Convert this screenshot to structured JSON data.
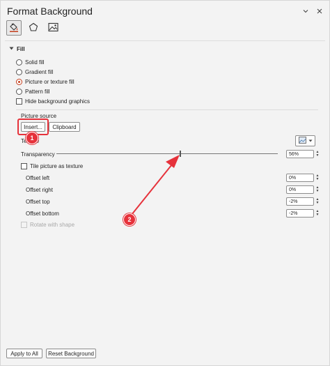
{
  "header": {
    "title": "Format Background",
    "chevron_icon": "chevron-down-icon",
    "close_icon": "close-icon"
  },
  "tabs": [
    {
      "name": "fill-tab",
      "icon": "paint-bucket-icon",
      "active": true
    },
    {
      "name": "effects-tab",
      "icon": "pentagon-icon",
      "active": false
    },
    {
      "name": "picture-tab",
      "icon": "image-icon",
      "active": false
    }
  ],
  "fill": {
    "section_label": "Fill",
    "options": [
      {
        "label": "Solid fill",
        "checked": false
      },
      {
        "label": "Gradient fill",
        "checked": false
      },
      {
        "label": "Picture or texture fill",
        "checked": true
      },
      {
        "label": "Pattern fill",
        "checked": false
      }
    ],
    "hide_graphics_label": "Hide background graphics",
    "picture_source_label": "Picture source",
    "insert_label": "Insert...",
    "clipboard_label": "Clipboard",
    "texture_label": "Texture",
    "transparency_label": "Transparency",
    "transparency_value": "56%",
    "transparency_fraction": 0.56,
    "tile_label": "Tile picture as texture",
    "offsets": [
      {
        "label": "Offset left",
        "value": "0%"
      },
      {
        "label": "Offset right",
        "value": "0%"
      },
      {
        "label": "Offset top",
        "value": "-2%"
      },
      {
        "label": "Offset bottom",
        "value": "-2%"
      }
    ],
    "rotate_label": "Rotate with shape"
  },
  "footer": {
    "apply_all_label": "Apply to All",
    "reset_label": "Reset Background"
  },
  "annotations": {
    "callout1": "1",
    "callout2": "2",
    "color": "#e6323b"
  }
}
